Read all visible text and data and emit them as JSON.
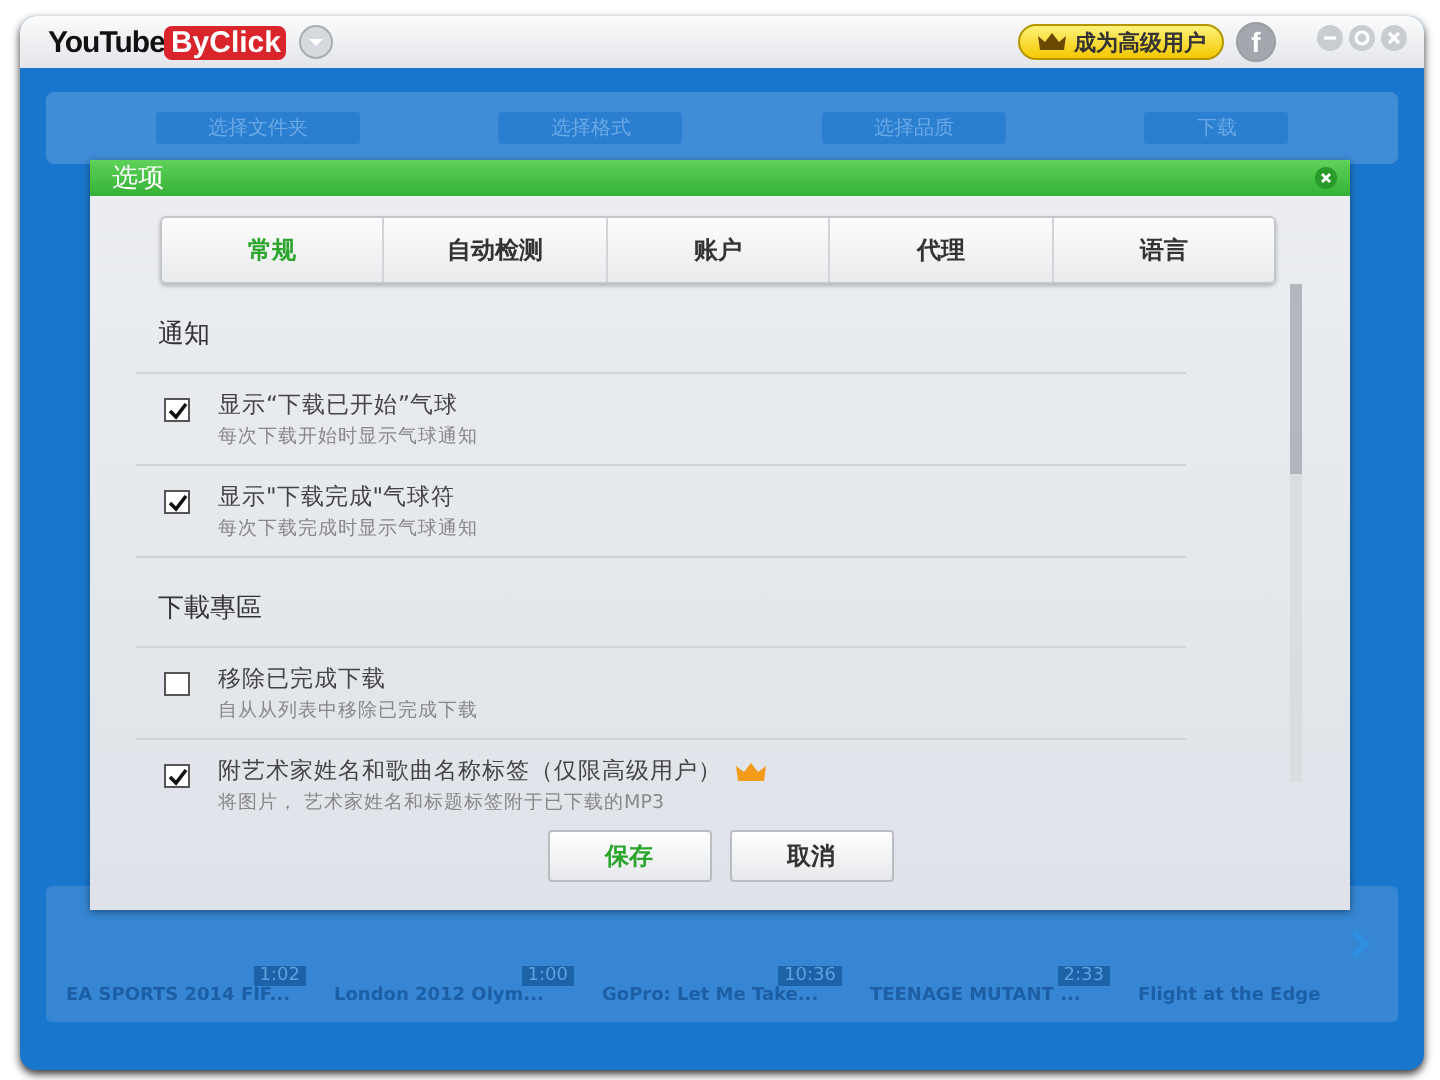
{
  "app": {
    "logo_left": "YouTube",
    "logo_right": "ByClick",
    "premium_button": "成为高级用户",
    "facebook_button": "f"
  },
  "steps": [
    "选择文件夹",
    "选择格式",
    "选择品质",
    "下载"
  ],
  "dialog": {
    "title": "选项",
    "tabs": [
      {
        "label": "常规",
        "selected": true
      },
      {
        "label": "自动检测",
        "selected": false
      },
      {
        "label": "账户",
        "selected": false
      },
      {
        "label": "代理",
        "selected": false
      },
      {
        "label": "语言",
        "selected": false
      }
    ],
    "sections": [
      {
        "heading": "通知",
        "options": [
          {
            "label": "显示“下载已开始”气球",
            "description": "每次下载开始时显示气球通知",
            "checked": true,
            "premium": false
          },
          {
            "label": "显示\"下载完成\"气球符",
            "description": "每次下载完成时显示气球通知",
            "checked": true,
            "premium": false
          }
        ]
      },
      {
        "heading": "下載專區",
        "options": [
          {
            "label": "移除已完成下载",
            "description": "自从从列表中移除已完成下载",
            "checked": false,
            "premium": false
          },
          {
            "label": "附艺术家姓名和歌曲名称标签（仅限高级用户）",
            "description": "将图片， 艺术家姓名和标题标签附于已下载的MP3",
            "checked": true,
            "premium": true
          }
        ]
      }
    ],
    "buttons": [
      {
        "label": "保存",
        "kind": "primary"
      },
      {
        "label": "取消",
        "kind": "secondary"
      }
    ]
  },
  "videos": [
    {
      "title": "EA SPORTS 2014 FIF...",
      "duration": "1:02"
    },
    {
      "title": "London 2012 Olym...",
      "duration": "1:00"
    },
    {
      "title": "GoPro: Let Me Take...",
      "duration": "10:36"
    },
    {
      "title": "TEENAGE MUTANT ...",
      "duration": "2:33"
    },
    {
      "title": "Flight at the Edge"
    }
  ]
}
